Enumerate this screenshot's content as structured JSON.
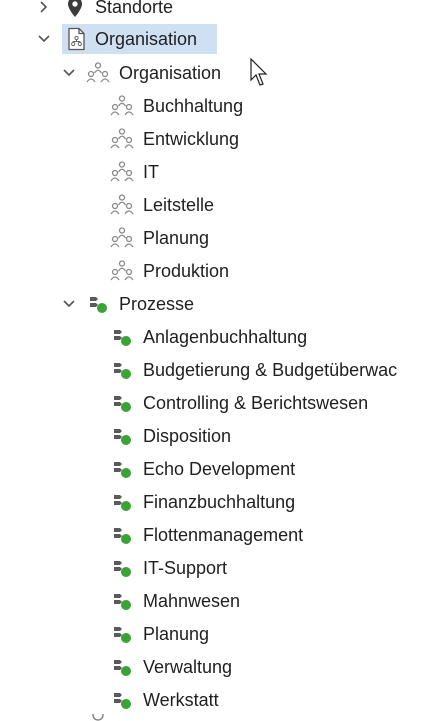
{
  "tree": {
    "standorte": {
      "label": "Standorte",
      "icon": "location-pin-icon"
    },
    "organisation_root": {
      "label": "Organisation",
      "icon": "org-document-icon"
    },
    "organisation_group": {
      "label": "Organisation",
      "icon": "people-hierarchy-icon",
      "items": [
        {
          "label": "Buchhaltung"
        },
        {
          "label": "Entwicklung"
        },
        {
          "label": "IT"
        },
        {
          "label": "Leitstelle"
        },
        {
          "label": "Planung"
        },
        {
          "label": "Produktion"
        }
      ]
    },
    "prozesse_group": {
      "label": "Prozesse",
      "icon": "process-icon",
      "items": [
        {
          "label": "Anlagenbuchhaltung"
        },
        {
          "label": "Budgetierung & Budgetüberwac"
        },
        {
          "label": "Controlling & Berichtswesen"
        },
        {
          "label": "Disposition"
        },
        {
          "label": "Echo Development"
        },
        {
          "label": "Finanzbuchhaltung"
        },
        {
          "label": "Flottenmanagement"
        },
        {
          "label": "IT-Support"
        },
        {
          "label": "Mahnwesen"
        },
        {
          "label": "Planung"
        },
        {
          "label": "Verwaltung"
        },
        {
          "label": "Werkstatt"
        }
      ]
    }
  },
  "colors": {
    "selection": "#cfe0f3",
    "text": "#1f1f1f",
    "process_green": "#3aa335",
    "process_gray": "#5a5a5a",
    "people_gray": "#8a8a8a"
  }
}
